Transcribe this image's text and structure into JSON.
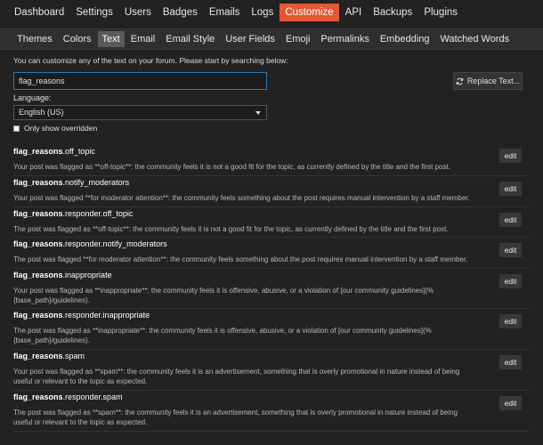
{
  "top_nav": [
    "Dashboard",
    "Settings",
    "Users",
    "Badges",
    "Emails",
    "Logs",
    "Customize",
    "API",
    "Backups",
    "Plugins"
  ],
  "top_nav_active": "Customize",
  "sub_nav": [
    "Themes",
    "Colors",
    "Text",
    "Email",
    "Email Style",
    "User Fields",
    "Emoji",
    "Permalinks",
    "Embedding",
    "Watched Words"
  ],
  "sub_nav_active": "Text",
  "intro_text": "You can customize any of the text on your forum. Please start by searching below:",
  "search": {
    "value": "flag_reasons"
  },
  "replace_button": "Replace Text...",
  "language": {
    "label": "Language:",
    "selected": "English (US)"
  },
  "only_overridden_label": "Only show overridden",
  "edit_label": "edit",
  "entries": [
    {
      "key_prefix": "flag_reasons",
      "key_suffix": ".off_topic",
      "value": "Your post was flagged as **off-topic**: the community feels it is not a good fit for the topic, as currently defined by the title and the first post."
    },
    {
      "key_prefix": "flag_reasons",
      "key_suffix": ".notify_moderators",
      "value": "Your post was flagged **for moderator attention**: the community feels something about the post requires manual intervention by a staff member."
    },
    {
      "key_prefix": "flag_reasons",
      "key_suffix": ".responder.off_topic",
      "value": "The post was flagged as **off-topic**: the community feels it is not a good fit for the topic, as currently defined by the title and the first post."
    },
    {
      "key_prefix": "flag_reasons",
      "key_suffix": ".responder.notify_moderators",
      "value": "The post was flagged **for moderator attention**: the community feels something about the post requires manual intervention by a staff member."
    },
    {
      "key_prefix": "flag_reasons",
      "key_suffix": ".inappropriate",
      "value": "Your post was flagged as **inappropriate**: the community feels it is offensive, abusive, or a violation of [our community guidelines](%{base_path}/guidelines)."
    },
    {
      "key_prefix": "flag_reasons",
      "key_suffix": ".responder.inappropriate",
      "value": "The post was flagged as **inappropriate**: the community feels it is offensive, abusive, or a violation of [our community guidelines](%{base_path}/guidelines)."
    },
    {
      "key_prefix": "flag_reasons",
      "key_suffix": ".spam",
      "value": "Your post was flagged as **spam**: the community feels it is an advertisement, something that is overly promotional in nature instead of being useful or relevant to the topic as expected."
    },
    {
      "key_prefix": "flag_reasons",
      "key_suffix": ".responder.spam",
      "value": "The post was flagged as **spam**: the community feels it is an advertisement, something that is overly promotional in nature instead of being useful or relevant to the topic as expected."
    }
  ],
  "colors": {
    "accent": "#e45735",
    "focus_border": "#2b7bb9",
    "background": "#222222"
  }
}
